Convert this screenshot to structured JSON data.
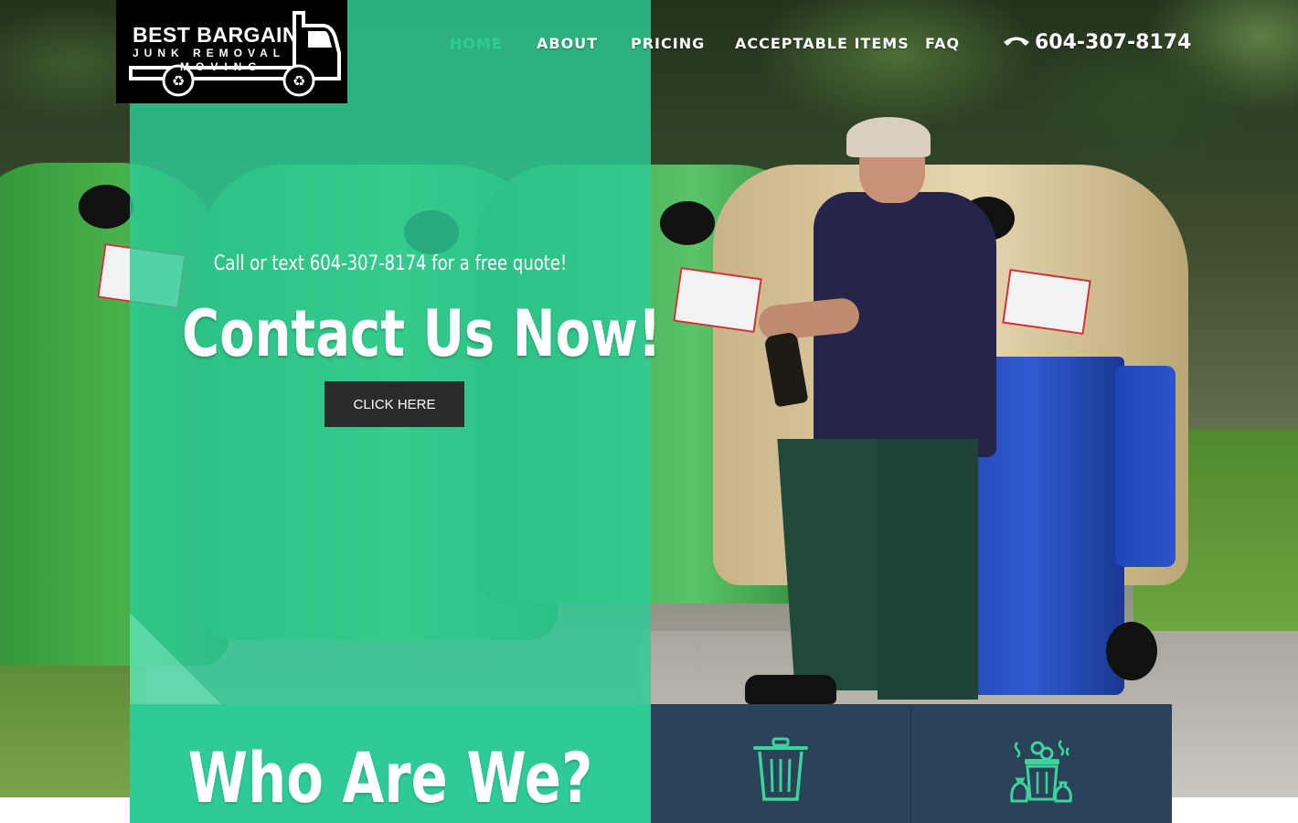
{
  "brand": {
    "line1": "BEST BARGAIN",
    "line2": "JUNK REMOVAL",
    "line3": "MOVING",
    "icon": "truck-recycle-logo"
  },
  "nav": {
    "items": [
      {
        "label": "HOME",
        "active": true
      },
      {
        "label": "ABOUT",
        "active": false
      },
      {
        "label": "PRICING",
        "active": false
      },
      {
        "label": "ACCEPTABLE ITEMS",
        "active": false
      },
      {
        "label": "FAQ",
        "active": false
      }
    ],
    "phone": "604-307-8174",
    "phone_icon": "phone-icon"
  },
  "hero": {
    "subhead": "Call or text 604-307-8174 for a free quote!",
    "headline": "Contact Us Now!",
    "cta_label": "CLICK HERE"
  },
  "section": {
    "title": "Who Are We?"
  },
  "cards": [
    {
      "icon": "trash-can-icon"
    },
    {
      "icon": "garbage-bags-icon"
    }
  ],
  "colors": {
    "accent": "#2ecc96",
    "panel_green": "#2dcc96",
    "dark_blue": "#2a4359",
    "button": "#2b2b2b",
    "icon_green": "#3ed39c"
  }
}
